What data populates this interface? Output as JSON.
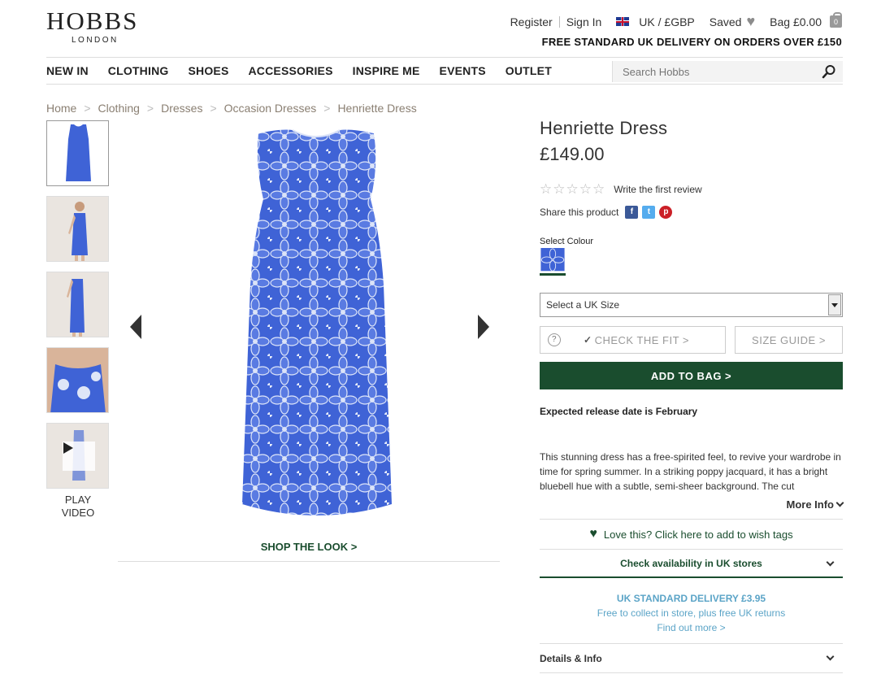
{
  "brand": {
    "name": "HOBBS",
    "sub": "LONDON"
  },
  "util": {
    "register": "Register",
    "sign_in": "Sign In",
    "currency": "UK / £GBP",
    "saved": "Saved",
    "bag": "Bag £0.00",
    "bag_count": "0"
  },
  "delivery_banner": "FREE STANDARD UK DELIVERY ON ORDERS OVER £150",
  "nav": {
    "items": [
      "NEW IN",
      "CLOTHING",
      "SHOES",
      "ACCESSORIES",
      "INSPIRE ME",
      "EVENTS",
      "OUTLET"
    ],
    "search_placeholder": "Search Hobbs"
  },
  "breadcrumb": [
    "Home",
    "Clothing",
    "Dresses",
    "Occasion Dresses",
    "Henriette Dress"
  ],
  "thumbnails": {
    "play_label_1": "PLAY",
    "play_label_2": "VIDEO"
  },
  "shop_the_look": "SHOP THE LOOK >",
  "product": {
    "title": "Henriette Dress",
    "price": "£149.00",
    "review_link": "Write the first review",
    "share_label": "Share this product",
    "select_colour": "Select Colour",
    "size_placeholder": "Select a UK Size",
    "check_fit": "CHECK THE FIT >",
    "size_guide": "SIZE GUIDE >",
    "add_to_bag": "ADD TO BAG >",
    "release": "Expected release date is February",
    "description": "This stunning dress has a free-spirited feel, to revive your wardrobe in time for spring summer. In a striking poppy jacquard, it has a bright bluebell hue with a subtle, semi-sheer background. The cut",
    "more_info": "More Info",
    "wish": "Love this? Click here to add to wish tags",
    "availability": "Check availability in UK stores",
    "delivery_1": "UK STANDARD DELIVERY £3.95",
    "delivery_2": "Free to collect in store, plus free UK returns",
    "delivery_3": "Find out more >",
    "details": "Details & Info"
  },
  "colors": {
    "accent_green": "#1a4d2e",
    "dress_blue": "#3f63d6",
    "delivery_blue": "#5ba4c7"
  }
}
